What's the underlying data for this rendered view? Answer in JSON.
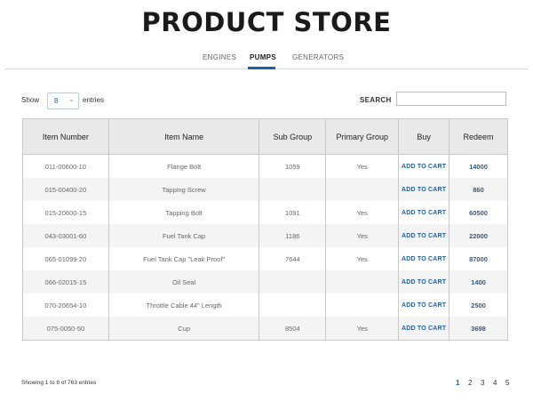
{
  "page": {
    "title": "PRODUCT STORE"
  },
  "tabs": [
    {
      "label": "ENGINES",
      "active": false
    },
    {
      "label": "PUMPS",
      "active": true
    },
    {
      "label": "GENERATORS",
      "active": false
    }
  ],
  "controls": {
    "show_label": "Show",
    "entries_value": "8",
    "entries_label": "entries",
    "search_label": "SEARCH",
    "search_value": ""
  },
  "table": {
    "columns": [
      "Item Number",
      "Item Name",
      "Sub Group",
      "Primary Group",
      "Buy",
      "Redeem"
    ],
    "rows": [
      {
        "item_number": "011-00600-10",
        "item_name": "Flange Bolt",
        "sub_group": "1059",
        "primary_group": "Yes",
        "buy": "ADD TO CART",
        "redeem": "14000"
      },
      {
        "item_number": "015-00400-20",
        "item_name": "Tapping Screw",
        "sub_group": "",
        "primary_group": "",
        "buy": "ADD TO CART",
        "redeem": "860"
      },
      {
        "item_number": "015-20600-15",
        "item_name": "Tapping Bolt",
        "sub_group": "1091",
        "primary_group": "Yes",
        "buy": "ADD TO CART",
        "redeem": "60500"
      },
      {
        "item_number": "043-03001-60",
        "item_name": "Fuel Tank Cap",
        "sub_group": "1186",
        "primary_group": "Yes",
        "buy": "ADD TO CART",
        "redeem": "22000"
      },
      {
        "item_number": "065-01099-20",
        "item_name": "Fuel Tank Cap \"Leak Proof\"",
        "sub_group": "7644",
        "primary_group": "Yes",
        "buy": "ADD TO CART",
        "redeem": "87000"
      },
      {
        "item_number": "066-02015-15",
        "item_name": "Oil Seal",
        "sub_group": "",
        "primary_group": "",
        "buy": "ADD TO CART",
        "redeem": "1400"
      },
      {
        "item_number": "070-20654-10",
        "item_name": "Throttle Cable 44\" Length",
        "sub_group": "",
        "primary_group": "",
        "buy": "ADD TO CART",
        "redeem": "2500"
      },
      {
        "item_number": "075-0050-50",
        "item_name": "Cup",
        "sub_group": "8504",
        "primary_group": "Yes",
        "buy": "ADD TO CART",
        "redeem": "3698"
      }
    ]
  },
  "footer": {
    "info": "Showing 1 to 8 of 763 entries",
    "pages": [
      "1",
      "2",
      "3",
      "4",
      "5"
    ],
    "current_page": "1"
  },
  "colors": {
    "accent": "#1f5fa8",
    "header_bg": "#e9e9e9"
  }
}
